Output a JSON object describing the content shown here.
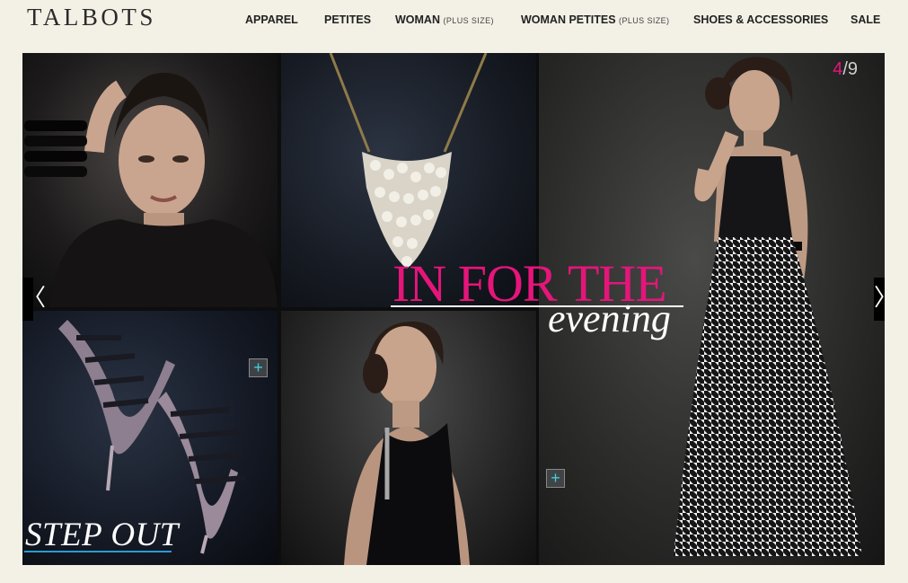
{
  "brand": {
    "logo_text": "TALBOTS"
  },
  "nav": {
    "apparel": "APPAREL",
    "petites": "PETITES",
    "woman": "WOMAN",
    "woman_sub": "(PLUS SIZE)",
    "woman_petites": "WOMAN PETITES",
    "woman_petites_sub": "(PLUS SIZE)",
    "shoes": "SHOES & ACCESSORIES",
    "sale": "SALE"
  },
  "slideshow": {
    "current": "4",
    "separator": "/",
    "total": "9",
    "headline": "IN FOR THE",
    "subheadline": "evening",
    "feature_label": "STEP OUT",
    "plus_symbol": "+",
    "prev_symbol": "〈",
    "next_symbol": "〉"
  },
  "colors": {
    "accent_pink": "#e5157a",
    "accent_blue": "#2a9bd4",
    "accent_teal": "#3fd0d8",
    "page_bg": "#f3f1e6"
  },
  "icons": {
    "plus": "plus-icon",
    "prev": "chevron-left-icon",
    "next": "chevron-right-icon"
  }
}
